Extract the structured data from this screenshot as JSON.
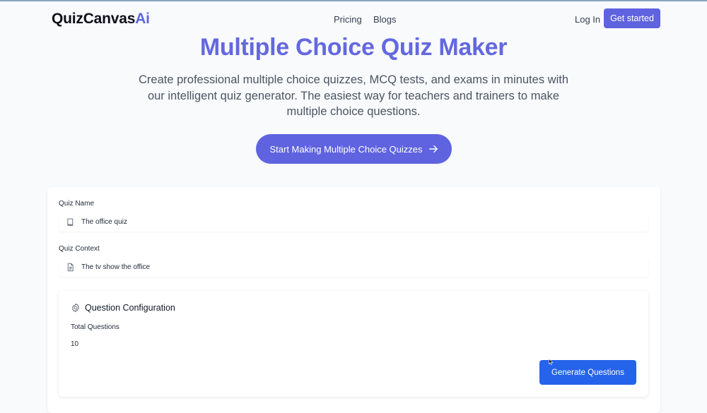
{
  "header": {
    "logo_main": "QuizCanvas",
    "logo_accent": "Ai",
    "nav_pricing": "Pricing",
    "nav_blogs": "Blogs",
    "login": "Log In",
    "get_started": "Get started"
  },
  "hero": {
    "title": "Multiple Choice Quiz Maker",
    "subtitle": "Create professional multiple choice quizzes, MCQ tests, and exams in minutes with our intelligent quiz generator. The easiest way for teachers and trainers to make multiple choice questions.",
    "cta_label": "Start Making Multiple Choice Quizzes"
  },
  "form": {
    "quiz_name_label": "Quiz Name",
    "quiz_name_value": "The office quiz",
    "quiz_context_label": "Quiz Context",
    "quiz_context_value": "The tv show the office",
    "config_title": "Question Configuration",
    "total_questions_label": "Total Questions",
    "total_questions_value": "10",
    "generate_label": "Generate Questions"
  },
  "colors": {
    "brand": "#5f63df",
    "title": "#6468df",
    "generate_button": "#2563eb"
  },
  "icons": {
    "quiz_name": "book-icon",
    "quiz_context": "document-icon",
    "config": "gear-icon",
    "cta": "arrow-right-icon"
  }
}
